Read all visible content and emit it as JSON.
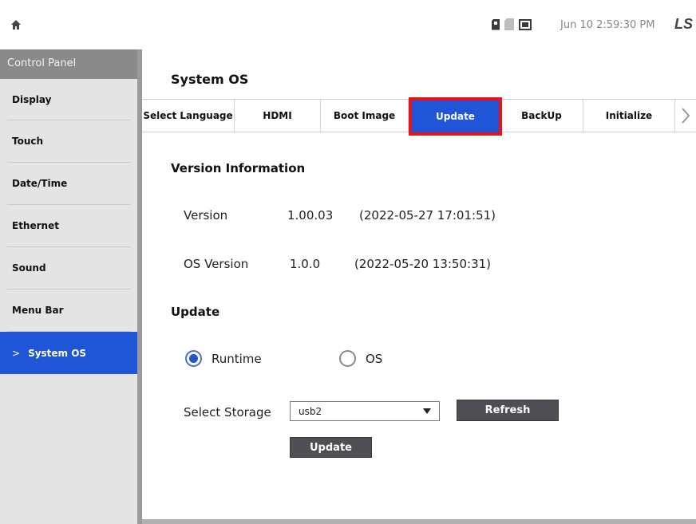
{
  "topbar": {
    "home_icon": "home-icon",
    "datetime": "Jun 10 2:59:30 PM",
    "logo": "LS",
    "status_icons": [
      "sd-card-icon",
      "sd-card-empty-icon",
      "usb-drive-icon"
    ]
  },
  "sidebar": {
    "header": "Control Panel",
    "items": [
      {
        "label": "Display"
      },
      {
        "label": "Touch"
      },
      {
        "label": "Date/Time"
      },
      {
        "label": "Ethernet"
      },
      {
        "label": "Sound"
      },
      {
        "label": "Menu Bar"
      },
      {
        "label": "System OS",
        "active": true,
        "prefix": ">"
      }
    ]
  },
  "main": {
    "title": "System OS",
    "tabs": [
      {
        "label": "Select Language"
      },
      {
        "label": "HDMI"
      },
      {
        "label": "Boot Image"
      },
      {
        "label": "Update",
        "active": true
      },
      {
        "label": "BackUp"
      },
      {
        "label": "Initialize"
      }
    ],
    "tab_more_icon": "chevron-right-icon",
    "version_section": {
      "title": "Version Information",
      "version_label": "Version",
      "version_value": "1.00.03",
      "version_date": "(2022-05-27 17:01:51)",
      "os_label": "OS Version",
      "os_value": "1.0.0",
      "os_date": "(2022-05-20 13:50:31)"
    },
    "update_section": {
      "title": "Update",
      "radio_options": [
        {
          "label": "Runtime",
          "selected": true
        },
        {
          "label": "OS",
          "selected": false
        }
      ],
      "storage_label": "Select Storage",
      "storage_value": "usb2",
      "refresh_label": "Refresh",
      "update_label": "Update"
    }
  },
  "colors": {
    "accent": "#1f55d6",
    "highlight_box": "#e3141b",
    "button_bg": "#4d4f55",
    "sidebar_header": "#8a8a8a"
  }
}
